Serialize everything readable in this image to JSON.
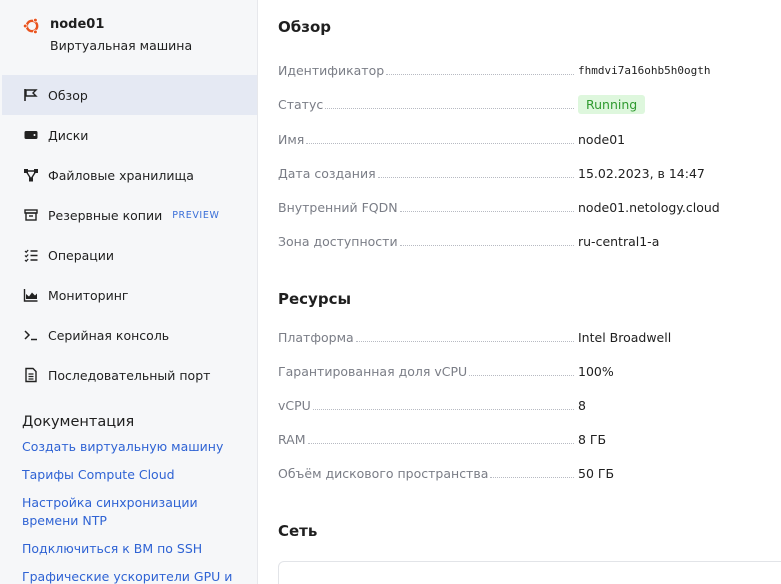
{
  "vm": {
    "name": "node01",
    "type": "Виртуальная машина"
  },
  "nav": [
    {
      "label": "Обзор",
      "icon": "overview-flag-icon"
    },
    {
      "label": "Диски",
      "icon": "disks-icon"
    },
    {
      "label": "Файловые хранилища",
      "icon": "file-storage-icon"
    },
    {
      "label": "Резервные копии",
      "icon": "backup-icon",
      "badge": "PREVIEW"
    },
    {
      "label": "Операции",
      "icon": "operations-icon"
    },
    {
      "label": "Мониторинг",
      "icon": "monitoring-icon"
    },
    {
      "label": "Серийная консоль",
      "icon": "serial-console-icon"
    },
    {
      "label": "Последовательный порт",
      "icon": "serial-port-icon"
    }
  ],
  "docs": {
    "title": "Документация",
    "links": [
      "Создать виртуальную машину",
      "Тарифы Compute Cloud",
      "Настройка синхронизации времени NTP",
      "Подключиться к ВМ по SSH",
      "Графические ускорители GPU и"
    ]
  },
  "overview": {
    "title": "Обзор",
    "rows": [
      {
        "key": "Идентификатор",
        "value": "fhmdvi7a16ohb5h0ogth"
      },
      {
        "key": "Статус",
        "value": "Running"
      },
      {
        "key": "Имя",
        "value": "node01"
      },
      {
        "key": "Дата создания",
        "value": "15.02.2023, в 14:47"
      },
      {
        "key": "Внутренний FQDN",
        "value": "node01.netology.cloud"
      },
      {
        "key": "Зона доступности",
        "value": "ru-central1-a"
      }
    ]
  },
  "resources": {
    "title": "Ресурсы",
    "rows": [
      {
        "key": "Платформа",
        "value": "Intel Broadwell"
      },
      {
        "key": "Гарантированная доля vCPU",
        "value": "100%"
      },
      {
        "key": "vCPU",
        "value": "8"
      },
      {
        "key": "RAM",
        "value": "8 ГБ"
      },
      {
        "key": "Объём дискового пространства",
        "value": "50 ГБ"
      }
    ]
  },
  "network": {
    "title": "Сеть"
  },
  "colors": {
    "accent": "#2f63d4",
    "status_bg": "#def7dd",
    "status_text": "#2f9a2f",
    "ubuntu": "#e95420"
  }
}
